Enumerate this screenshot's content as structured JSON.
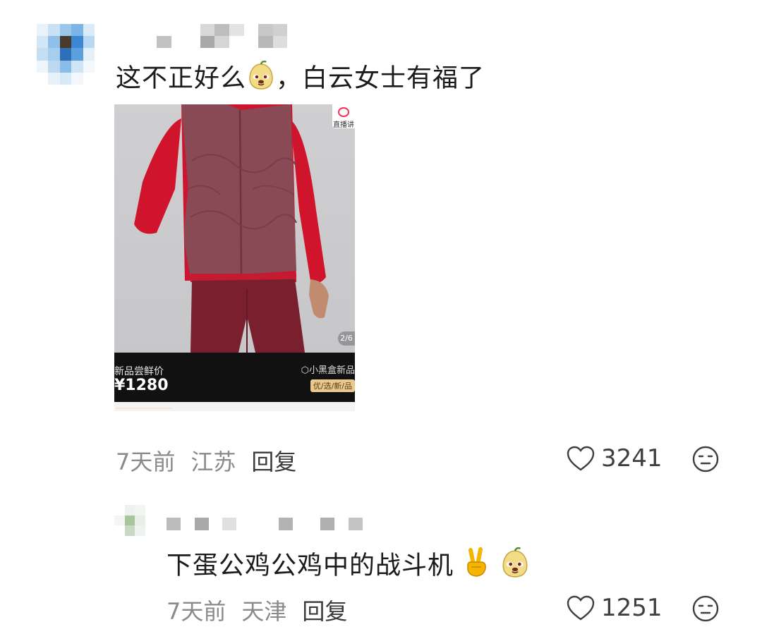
{
  "comment1": {
    "text": "这不正好么",
    "text_after_emoji": "，白云女士有福了",
    "emoji": "doge-pear-face-icon",
    "product": {
      "badge": "新品尝鲜价",
      "price": "¥1280",
      "shop": "小黑盒新品",
      "shop_tag": "优/选/新/品",
      "live_label": "直播讲",
      "pager": "2/6"
    },
    "time": "7天前",
    "location": "江苏",
    "reply_label": "回复",
    "likes": "3241"
  },
  "reply1": {
    "text": "下蛋公鸡公鸡中的战斗机",
    "emojis": [
      "victory-hand-icon",
      "doge-pear-face-icon"
    ],
    "time": "7天前",
    "location": "天津",
    "reply_label": "回复",
    "likes": "1251"
  },
  "colors": {
    "text": "#1b1b1b",
    "meta": "#8a8a8a",
    "vest": "#8a4a55",
    "shirt": "#d0142c",
    "pants": "#7a1f2d"
  }
}
